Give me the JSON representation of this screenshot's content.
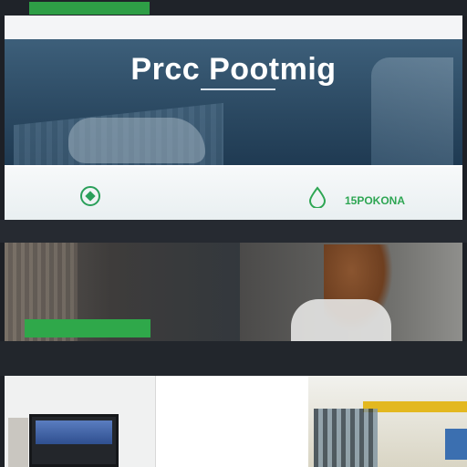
{
  "brand_tab": "",
  "nav": {
    "title": "",
    "links": [
      "",
      ""
    ]
  },
  "hero": {
    "title": "Prcc Pootmig",
    "subtitle": ""
  },
  "feature": {
    "text": "",
    "brand": "15POKONA"
  },
  "cards": {
    "left": {
      "heading": "",
      "body": "",
      "cta": ""
    },
    "right": {
      "heading": "",
      "body": ""
    }
  },
  "bottom": {
    "heading": "",
    "body": ""
  },
  "icons": {
    "feature_left": "diamond-badge-icon",
    "feature_right": "drop-icon"
  },
  "colors": {
    "accent_green": "#2ea653",
    "hero_blue": "#2c4a63"
  }
}
